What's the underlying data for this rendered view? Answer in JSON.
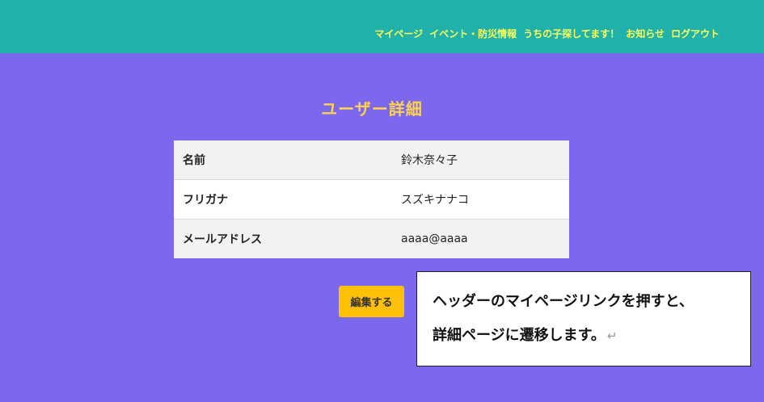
{
  "header": {
    "nav_items": [
      {
        "label": "マイページ"
      },
      {
        "label": "イベント・防災情報"
      },
      {
        "label": "うちの子探してます！"
      },
      {
        "label": "お知らせ"
      },
      {
        "label": "ログアウト"
      }
    ]
  },
  "main": {
    "title": "ユーザー詳細",
    "rows": [
      {
        "key": "名前",
        "value": "鈴木奈々子"
      },
      {
        "key": "フリガナ",
        "value": "スズキナナコ"
      },
      {
        "key": "メールアドレス",
        "value": "aaaa@aaaa"
      }
    ],
    "edit_button_label": "編集する"
  },
  "annotation": {
    "line1": "ヘッダーのマイページリンクを押すと、",
    "line2": "詳細ページに遷移します。",
    "return_mark": "↵"
  },
  "colors": {
    "background": "#7b68ee",
    "header": "#20b2aa",
    "nav_text": "#ffff55",
    "title": "#ffd24d",
    "button": "#ffc107"
  }
}
